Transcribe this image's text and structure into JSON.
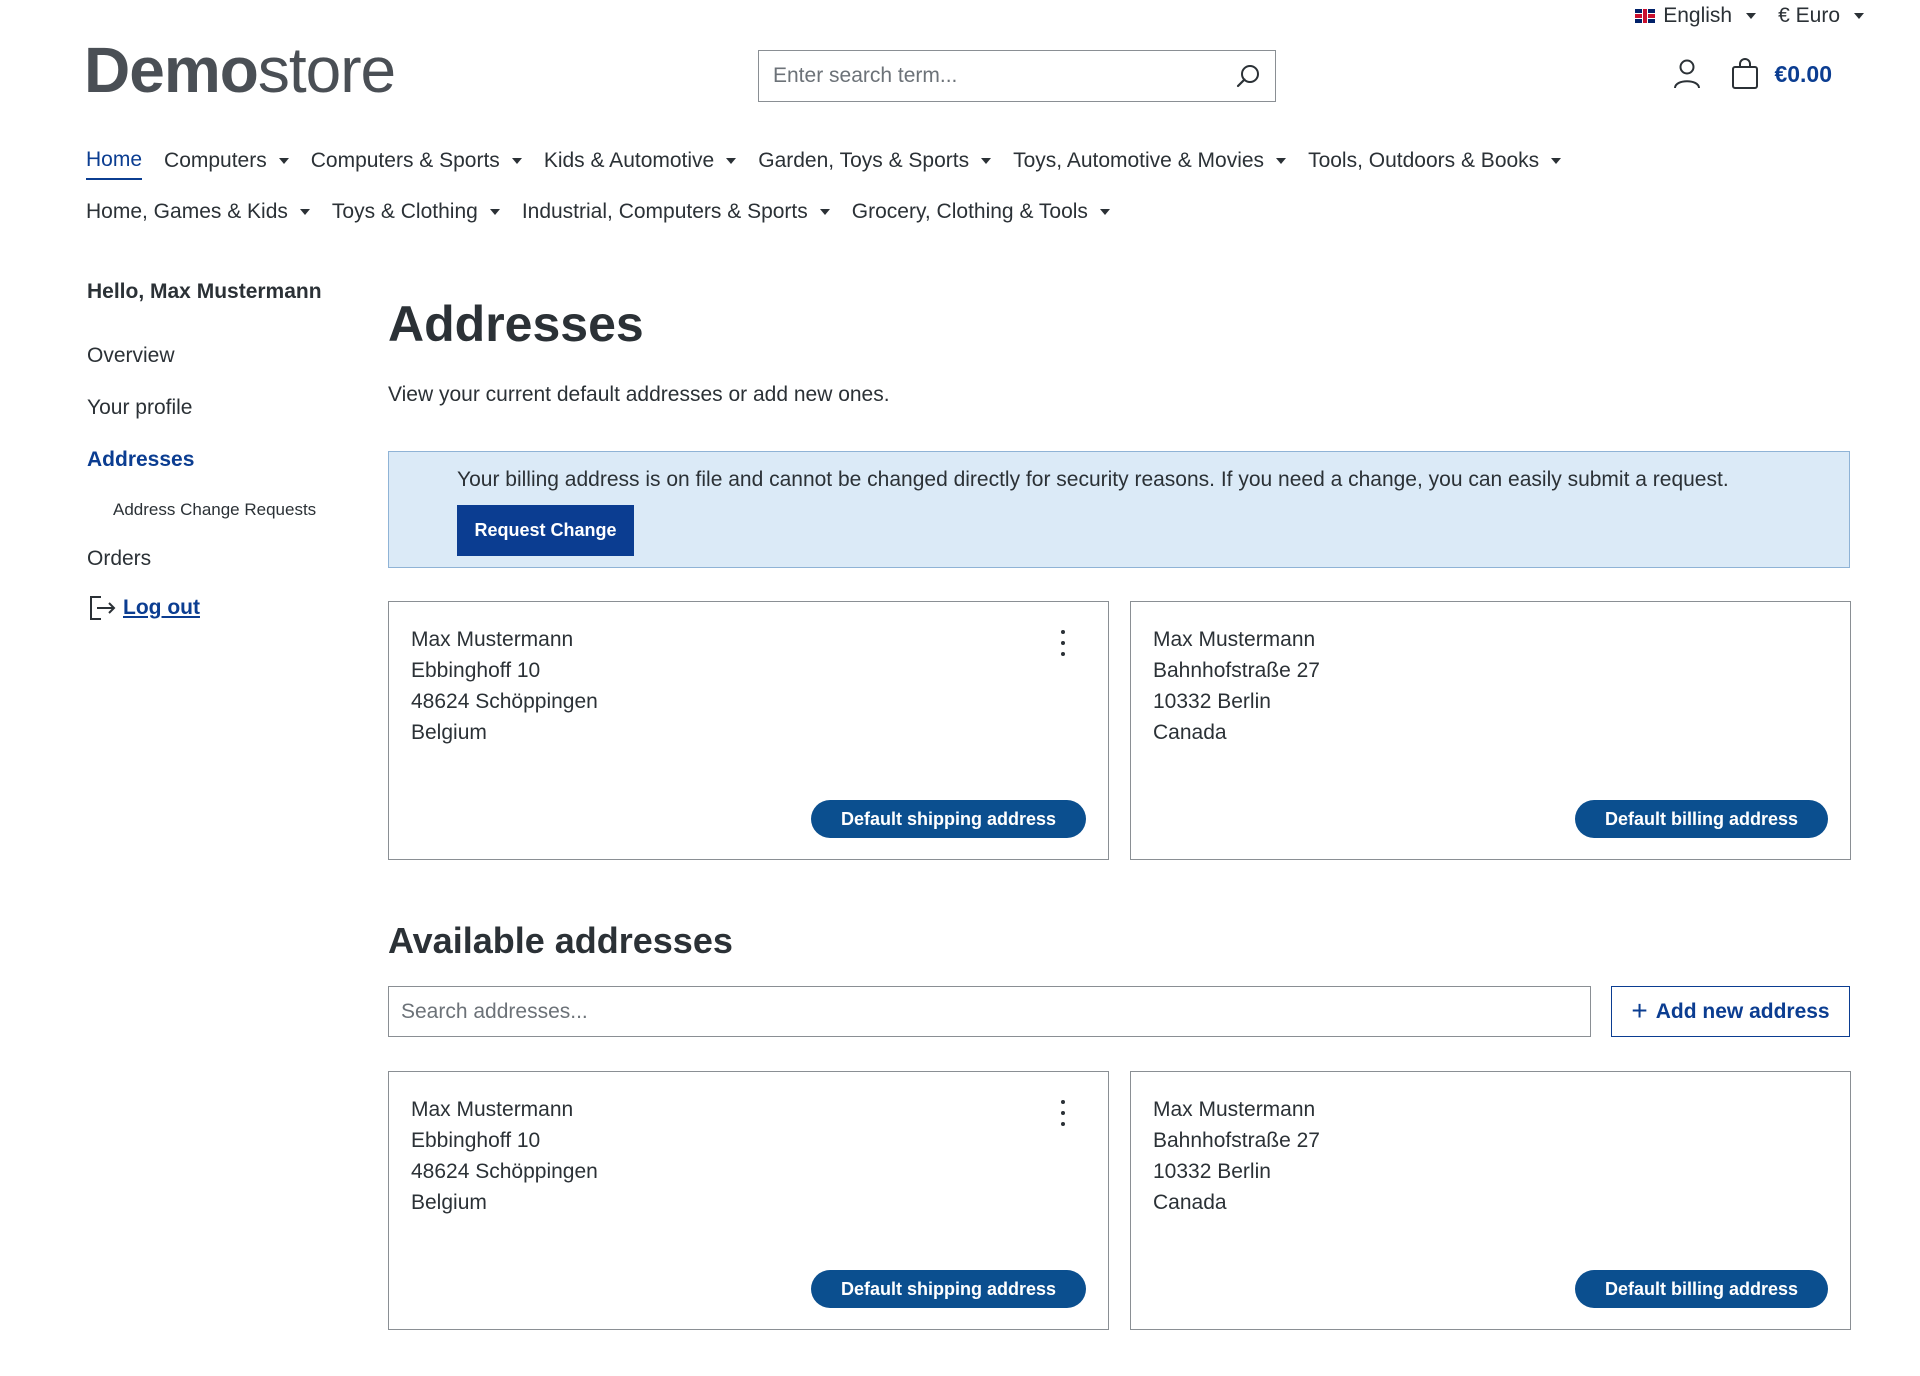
{
  "topbar": {
    "language": "English",
    "currency": "€ Euro"
  },
  "logo": {
    "bold": "Demo",
    "light": "store"
  },
  "search": {
    "placeholder": "Enter search term..."
  },
  "header": {
    "cart_total": "€0.00"
  },
  "nav": {
    "row1": [
      "Home",
      "Computers",
      "Computers & Sports",
      "Kids & Automotive",
      "Garden, Toys & Sports",
      "Toys, Automotive & Movies",
      "Tools, Outdoors & Books"
    ],
    "row2": [
      "Home, Games & Kids",
      "Toys & Clothing",
      "Industrial, Computers & Sports",
      "Grocery, Clothing & Tools"
    ]
  },
  "sidebar": {
    "greeting": "Hello, Max Mustermann",
    "overview": "Overview",
    "profile": "Your profile",
    "addresses": "Addresses",
    "change_requests": "Address Change Requests",
    "orders": "Orders",
    "logout": "Log out"
  },
  "main": {
    "title": "Addresses",
    "description": "View your current default addresses or add new ones.",
    "alert_text": "Your billing address is on file and cannot be changed directly for security reasons. If you need a change, you can easily submit a request.",
    "request_button": "Request Change",
    "default_cards": [
      {
        "lines": [
          "Max Mustermann",
          "Ebbinghoff 10",
          "48624 Schöppingen",
          "Belgium"
        ],
        "badge": "Default shipping address"
      },
      {
        "lines": [
          "Max Mustermann",
          "Bahnhofstraße 27",
          "10332 Berlin",
          "Canada"
        ],
        "badge": "Default billing address"
      }
    ],
    "available_title": "Available addresses",
    "search_placeholder": "Search addresses...",
    "add_button": "Add new address",
    "available_cards": [
      {
        "lines": [
          "Max Mustermann",
          "Ebbinghoff 10",
          "48624 Schöppingen",
          "Belgium"
        ],
        "badge": "Default shipping address"
      },
      {
        "lines": [
          "Max Mustermann",
          "Bahnhofstraße 27",
          "10332 Berlin",
          "Canada"
        ],
        "badge": "Default billing address"
      }
    ]
  },
  "colors": {
    "primary": "#0b3d91",
    "badge": "#0b4f8f",
    "alert_bg": "#dbeaf7"
  }
}
